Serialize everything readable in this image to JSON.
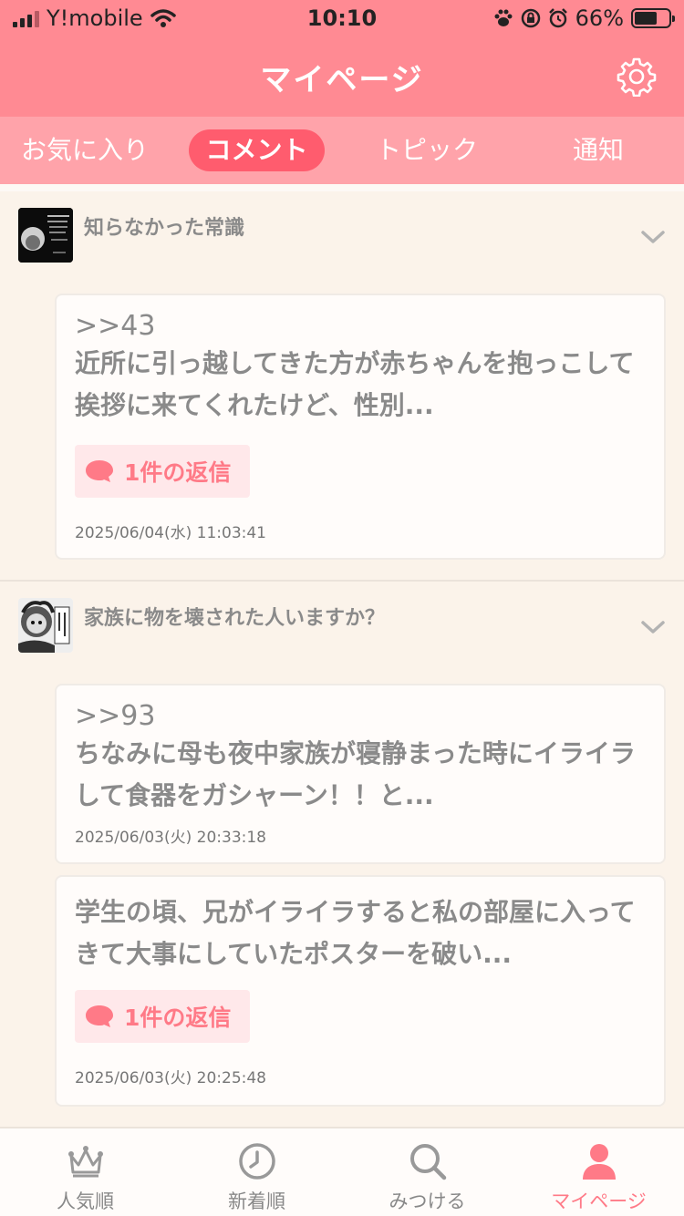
{
  "status": {
    "carrier": "Y!mobile",
    "time": "10:10",
    "battery": "66%",
    "battery_level": 0.66
  },
  "header": {
    "title": "マイページ"
  },
  "tabs": [
    {
      "label": "お気に入り"
    },
    {
      "label": "コメント",
      "active": true
    },
    {
      "label": "トピック"
    },
    {
      "label": "通知"
    }
  ],
  "topics": [
    {
      "title": "知らなかった常識",
      "comments": [
        {
          "number": ">>43",
          "text": "近所に引っ越してきた方が赤ちゃんを抱っこして挨拶に来てくれたけど、性別...",
          "reply_label": "1件の返信",
          "date": "2025/06/04(水) 11:03:41"
        }
      ]
    },
    {
      "title": "家族に物を壊された人いますか？",
      "comments": [
        {
          "number": ">>93",
          "text": "ちなみに母も夜中家族が寝静まった時にイライラして食器をガシャーン！！と...",
          "date": "2025/06/03(火) 20:33:18"
        },
        {
          "text": "学生の頃、兄がイライラすると私の部屋に入ってきて大事にしていたポスターを破い...",
          "reply_label": "1件の返信",
          "date": "2025/06/03(火) 20:25:48"
        }
      ]
    }
  ],
  "bottom_nav": [
    {
      "label": "人気順",
      "icon": "crown-icon"
    },
    {
      "label": "新着順",
      "icon": "clock-icon"
    },
    {
      "label": "みつける",
      "icon": "search-icon"
    },
    {
      "label": "マイページ",
      "icon": "person-icon",
      "active": true
    }
  ],
  "colors": {
    "header": "#ff8a93",
    "tab_bar": "#ffa3aa",
    "active_tab": "#ff5c6e",
    "accent": "#ff7a87",
    "background": "#fbf3ea"
  }
}
